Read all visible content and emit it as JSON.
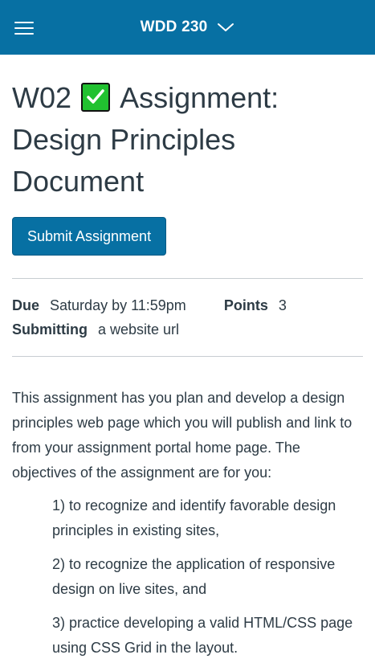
{
  "header": {
    "course_title": "WDD 230"
  },
  "page": {
    "title_prefix": "W02",
    "title_rest": "Assignment: Design Principles Document",
    "submit_label": "Submit Assignment"
  },
  "details": {
    "due_label": "Due",
    "due_value": "Saturday by 11:59pm",
    "points_label": "Points",
    "points_value": "3",
    "submitting_label": "Submitting",
    "submitting_value": "a website url"
  },
  "description": {
    "intro": "This assignment has you plan and develop a design principles web page which you will publish and link to from your assignment portal home page. The objectives of the assignment are for you:",
    "objectives": [
      "1) to recognize and identify favorable design principles in existing sites,",
      "2) to recognize the application of responsive design on live sites, and",
      "3) practice developing a valid HTML/CSS page using CSS Grid in the layout."
    ]
  },
  "colors": {
    "brand": "#0770a3",
    "check_green": "#21c130",
    "text": "#2d3b45"
  },
  "icons": {
    "menu": "hamburger-icon",
    "switch": "chevron-down-icon",
    "badge": "check-mark-icon"
  }
}
